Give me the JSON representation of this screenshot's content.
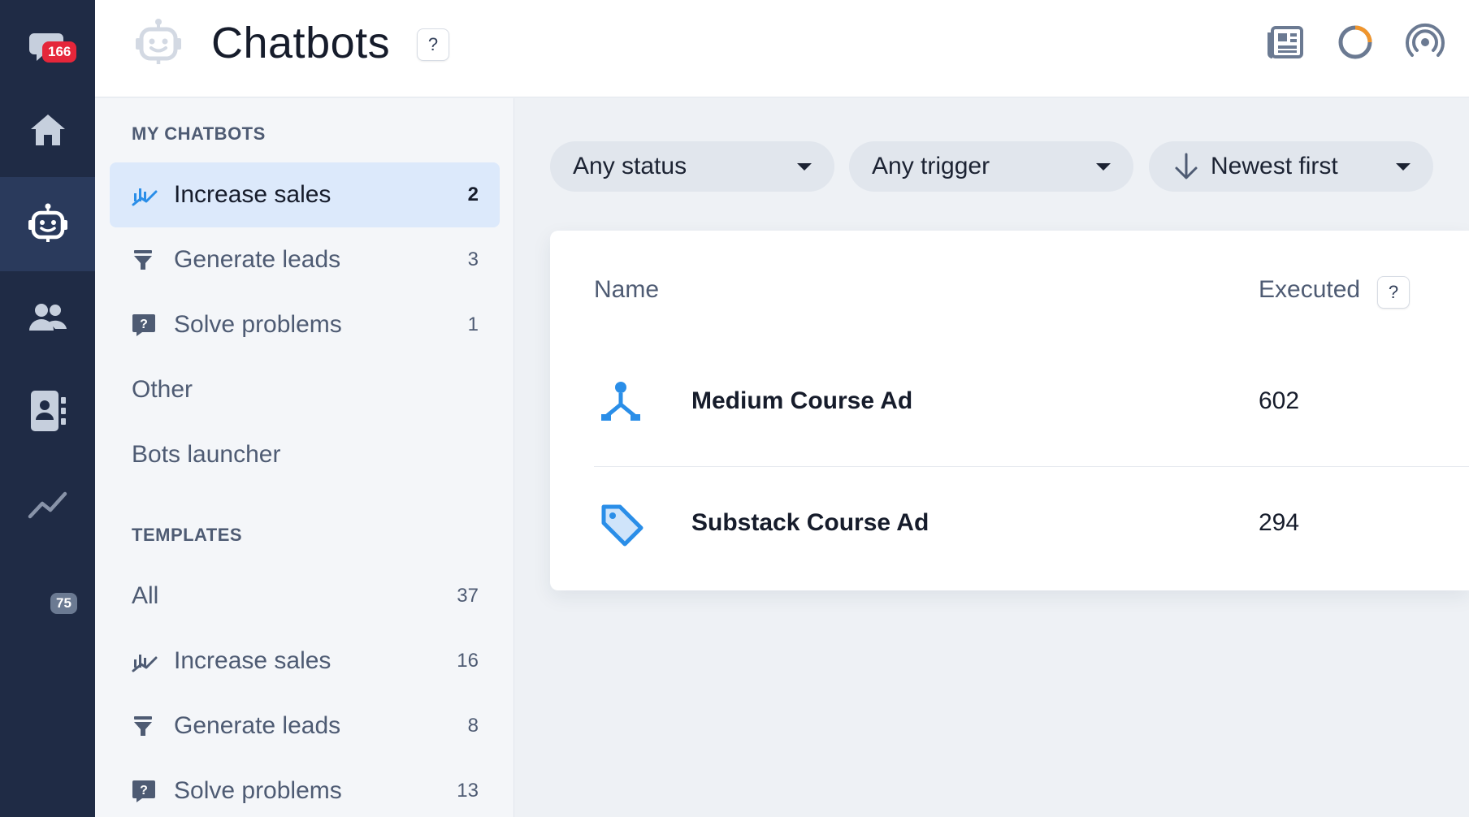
{
  "rail": {
    "conversations_badge": "166",
    "contacts_badge": "75",
    "items": [
      "chat-icon",
      "home-icon",
      "chatbot-icon",
      "contacts-icon",
      "address-book-icon",
      "analytics-icon"
    ]
  },
  "header": {
    "title": "Chatbots",
    "help": "?",
    "icons": [
      "newsfeed-icon",
      "progress-ring-icon",
      "broadcast-icon"
    ]
  },
  "sidebar": {
    "my_chatbots_title": "MY CHATBOTS",
    "my_items": [
      {
        "label": "Increase sales",
        "count": "2",
        "icon": "chart-hand-icon"
      },
      {
        "label": "Generate leads",
        "count": "3",
        "icon": "funnel-icon"
      },
      {
        "label": "Solve problems",
        "count": "1",
        "icon": "question-chat-icon"
      },
      {
        "label": "Other"
      },
      {
        "label": "Bots launcher"
      }
    ],
    "templates_title": "TEMPLATES",
    "template_items": [
      {
        "label": "All",
        "count": "37"
      },
      {
        "label": "Increase sales",
        "count": "16",
        "icon": "chart-hand-icon"
      },
      {
        "label": "Generate leads",
        "count": "8",
        "icon": "funnel-icon"
      },
      {
        "label": "Solve problems",
        "count": "13",
        "icon": "question-chat-icon"
      }
    ]
  },
  "filters": {
    "status": "Any status",
    "trigger": "Any trigger",
    "sort": "Newest first"
  },
  "table": {
    "col_name": "Name",
    "col_executed": "Executed",
    "help": "?",
    "rows": [
      {
        "name": "Medium Course Ad",
        "executed": "602",
        "icon": "branch-icon"
      },
      {
        "name": "Substack Course Ad",
        "executed": "294",
        "icon": "tag-icon"
      }
    ]
  },
  "colors": {
    "rail_bg": "#1f2b45",
    "accent": "#2a8ee8",
    "active_nav_bg": "#dce9fb",
    "badge_red": "#e5263a"
  }
}
